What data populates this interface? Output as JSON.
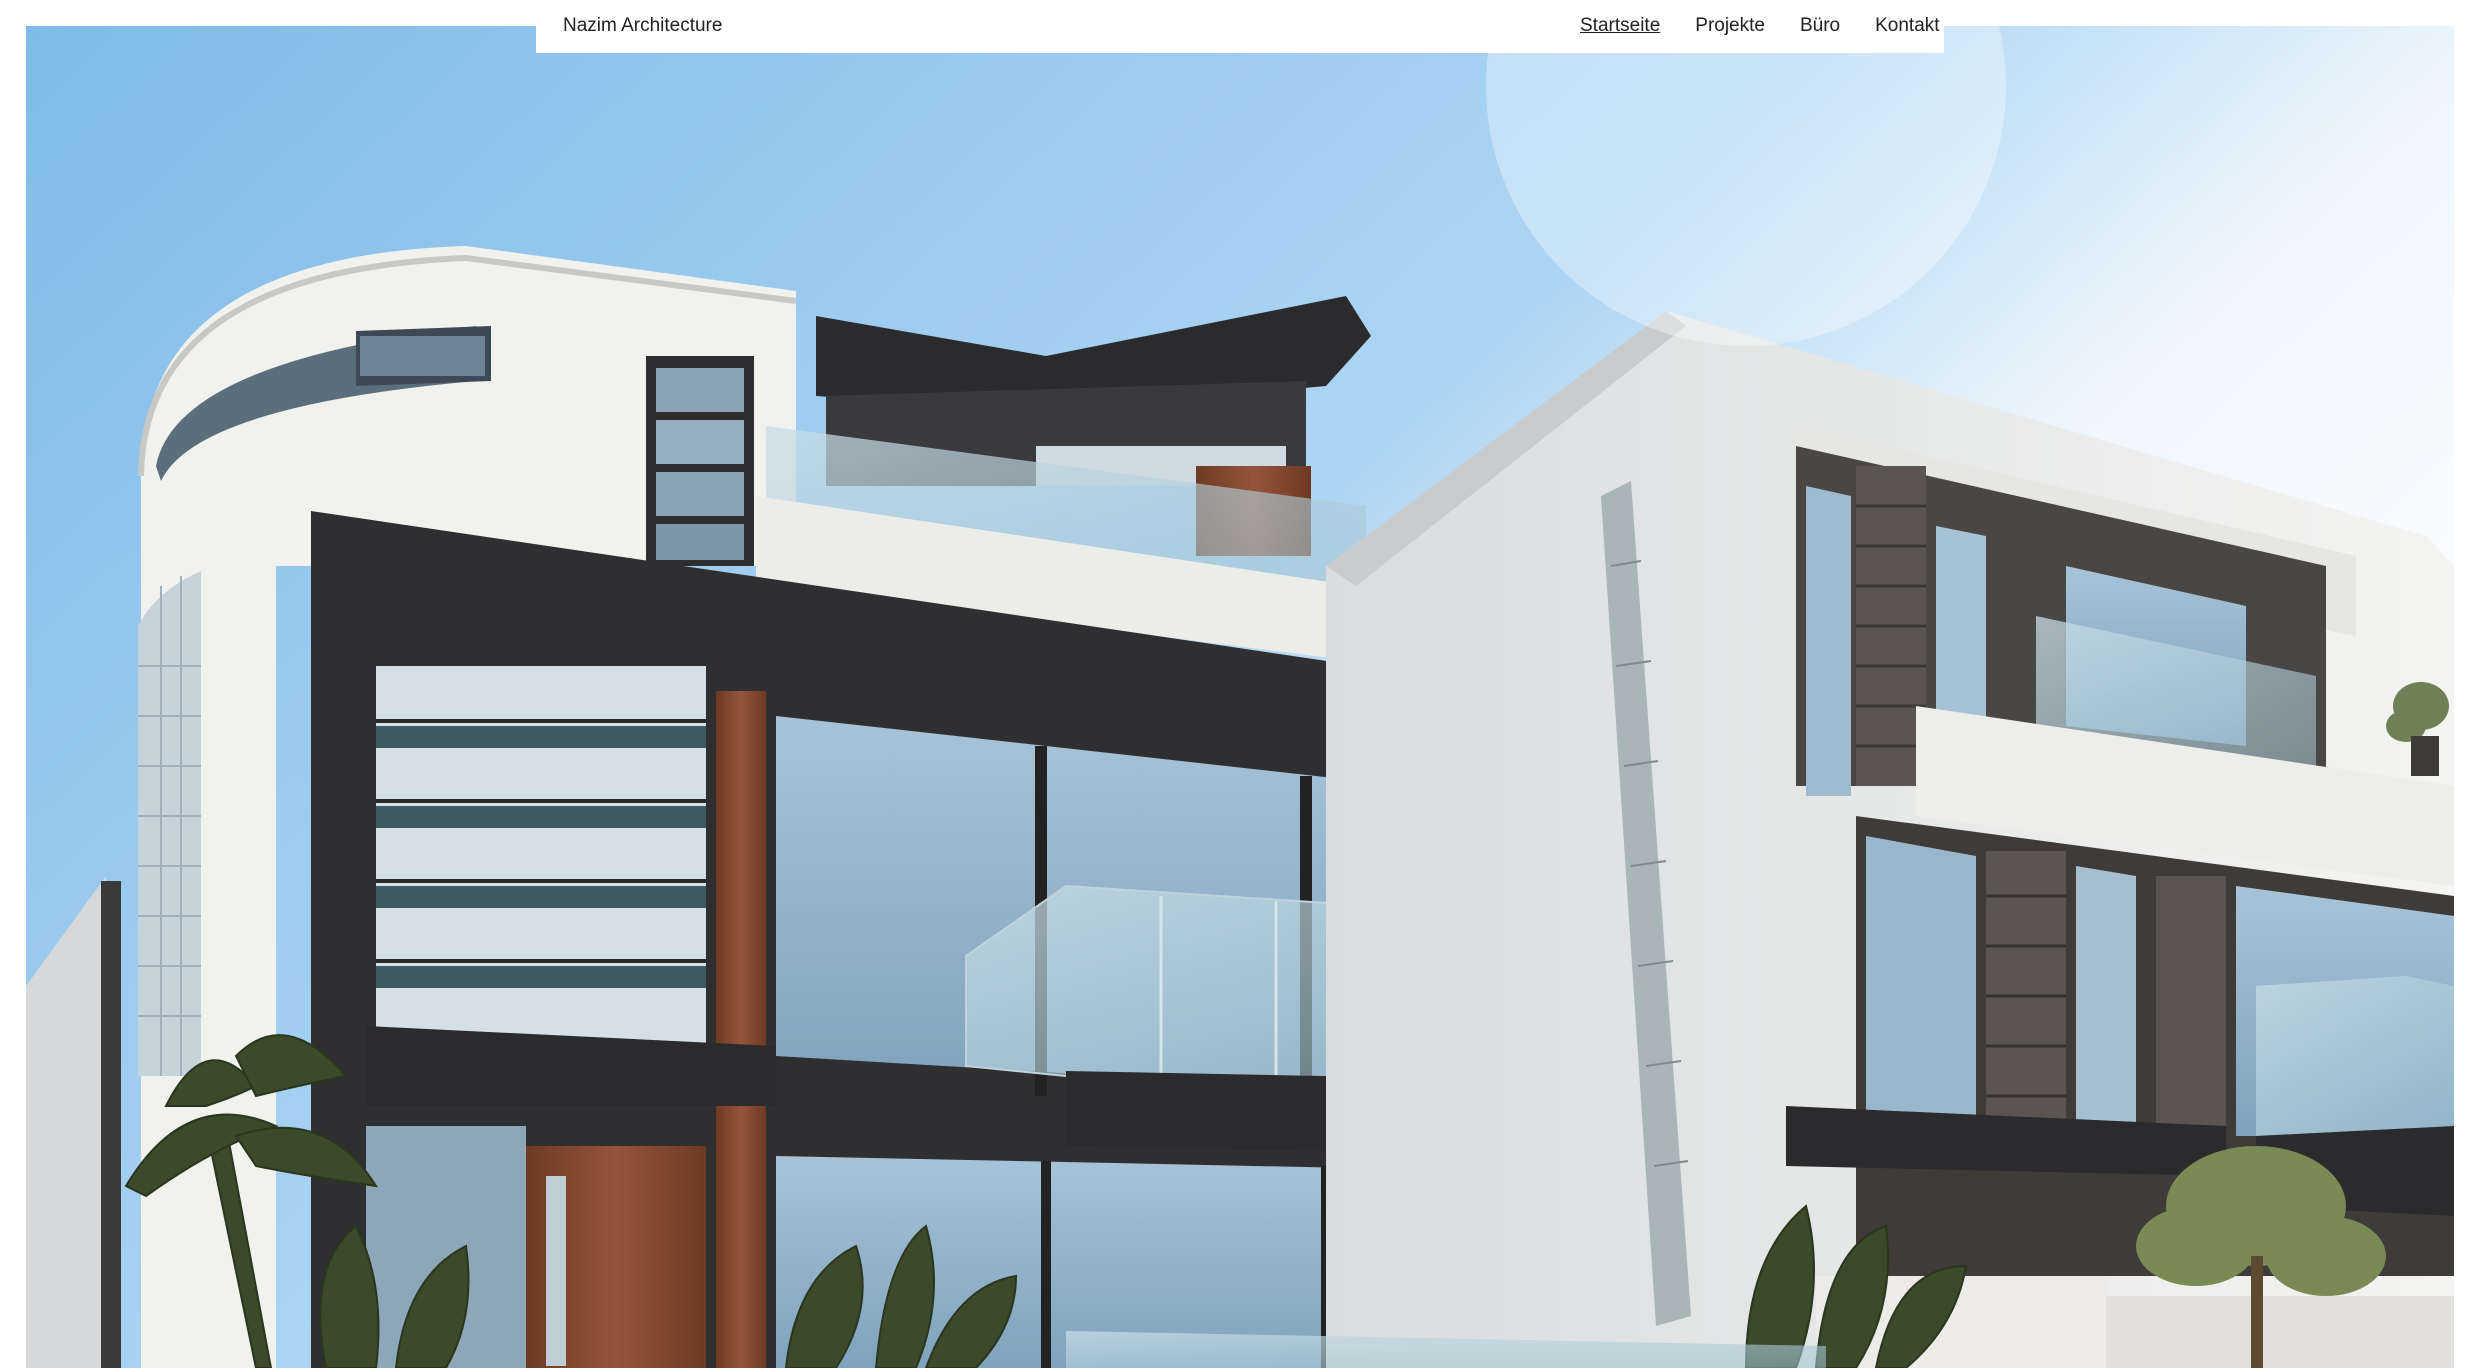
{
  "brand": {
    "name": "Nazim Architecture"
  },
  "nav": {
    "items": [
      {
        "label": "Startseite",
        "active": true
      },
      {
        "label": "Projekte",
        "active": false
      },
      {
        "label": "Büro",
        "active": false
      },
      {
        "label": "Kontakt",
        "active": false
      }
    ]
  },
  "hero": {
    "subject": "modern-house-photo"
  },
  "colors": {
    "sky": "#a9d2f2",
    "white_wall": "#f2f2f0",
    "dark_frame": "#2d2d2f",
    "glass": "#8fb6d0",
    "wood": "#8a4b2e",
    "stone": "#4a4644",
    "palm": "#3b4a2a"
  }
}
